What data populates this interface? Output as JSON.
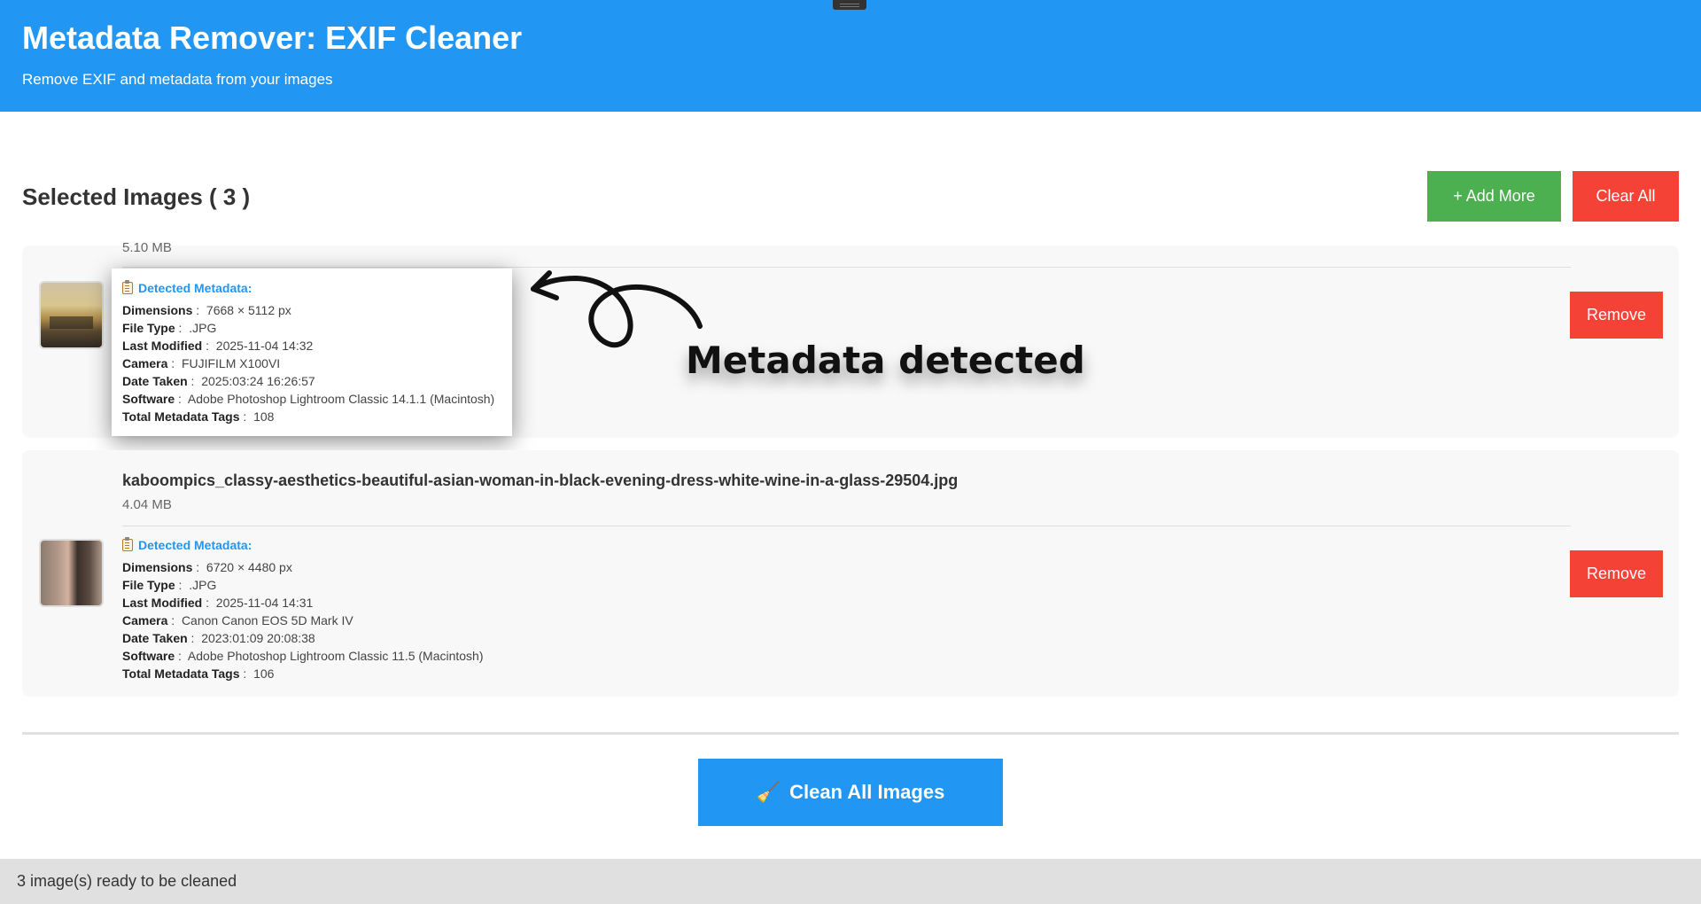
{
  "app": {
    "title": "Metadata Remover: EXIF Cleaner",
    "subtitle": "Remove EXIF and metadata from your images"
  },
  "toolbar": {
    "section_title": "Selected Images ( 3 )",
    "add_more_label": "+ Add More",
    "clear_all_label": "Clear All"
  },
  "images": [
    {
      "size": "5.10 MB",
      "metadata_header": "Detected Metadata:",
      "remove_label": "Remove",
      "rows": [
        {
          "label": "Dimensions",
          "value": "7668 × 5112 px"
        },
        {
          "label": "File Type",
          "value": ".JPG"
        },
        {
          "label": "Last Modified",
          "value": "2025-11-04 14:32"
        },
        {
          "label": "Camera",
          "value": "FUJIFILM X100VI"
        },
        {
          "label": "Date Taken",
          "value": "2025:03:24 16:26:57"
        },
        {
          "label": "Software",
          "value": "Adobe Photoshop Lightroom Classic 14.1.1 (Macintosh)"
        },
        {
          "label": "Total Metadata Tags",
          "value": "108"
        }
      ]
    },
    {
      "name": "kaboompics_classy-aesthetics-beautiful-asian-woman-in-black-evening-dress-white-wine-in-a-glass-29504.jpg",
      "size": "4.04 MB",
      "metadata_header": "Detected Metadata:",
      "remove_label": "Remove",
      "rows": [
        {
          "label": "Dimensions",
          "value": "6720 × 4480 px"
        },
        {
          "label": "File Type",
          "value": ".JPG"
        },
        {
          "label": "Last Modified",
          "value": "2025-11-04 14:31"
        },
        {
          "label": "Camera",
          "value": "Canon Canon EOS 5D Mark IV"
        },
        {
          "label": "Date Taken",
          "value": "2023:01:09 20:08:38"
        },
        {
          "label": "Software",
          "value": "Adobe Photoshop Lightroom Classic 11.5 (Macintosh)"
        },
        {
          "label": "Total Metadata Tags",
          "value": "106"
        }
      ]
    }
  ],
  "annotation": {
    "text": "Metadata detected"
  },
  "actions": {
    "clean_all_label": "Clean All Images",
    "clean_icon": "broom-icon"
  },
  "status": {
    "text": "3 image(s) ready to be cleaned"
  },
  "colors": {
    "primary": "#2196f3",
    "success": "#4caf50",
    "danger": "#f44336"
  }
}
